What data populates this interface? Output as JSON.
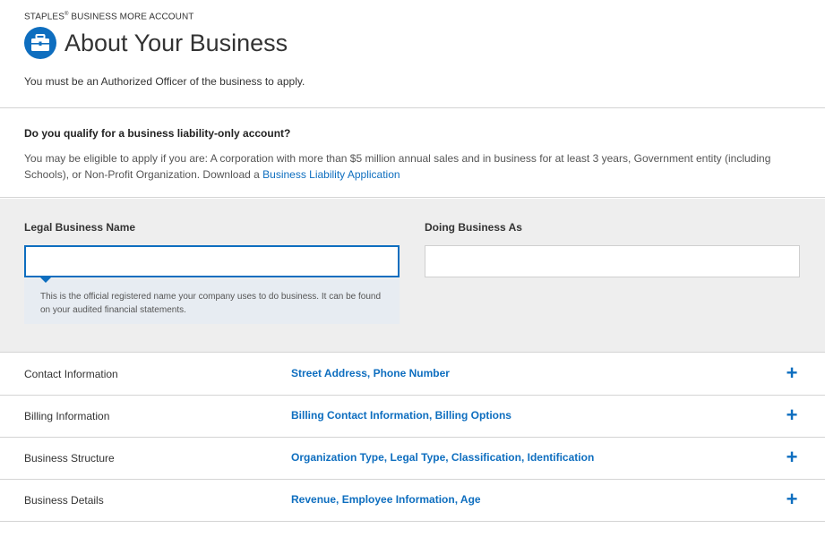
{
  "header": {
    "eyebrow": "STAPLES",
    "eyebrow_mark": "®",
    "eyebrow_rest": " BUSINESS MORE ACCOUNT",
    "icon": "briefcase-icon",
    "title": "About Your Business",
    "subtitle": "You must be an Authorized Officer of the business to apply."
  },
  "qualify": {
    "question": "Do you qualify for a business liability-only account?",
    "text": "You may be eligible to apply if you are: A corporation with more than $5 million annual sales and in business for at least 3 years, Government entity (including Schools), or Non-Profit Organization. Download a ",
    "link": "Business Liability Application"
  },
  "form": {
    "legal_name_label": "Legal Business Name",
    "legal_name_value": "",
    "dba_label": "Doing Business As",
    "dba_value": "",
    "legal_name_help": "This is the official registered name your company uses to do business. It can be found on your audited financial statements."
  },
  "sections": [
    {
      "title": "Contact Information",
      "summary": "Street Address, Phone Number",
      "toggle": "+"
    },
    {
      "title": "Billing Information",
      "summary": "Billing Contact Information, Billing Options",
      "toggle": "+"
    },
    {
      "title": "Business Structure",
      "summary": "Organization Type, Legal Type, Classification, Identification",
      "toggle": "+"
    },
    {
      "title": "Business Details",
      "summary": "Revenue, Employee Information, Age",
      "toggle": "+"
    }
  ],
  "colors": {
    "accent": "#0e6ebf",
    "form_background": "#eeeeee",
    "divider": "#d4d4d4"
  }
}
